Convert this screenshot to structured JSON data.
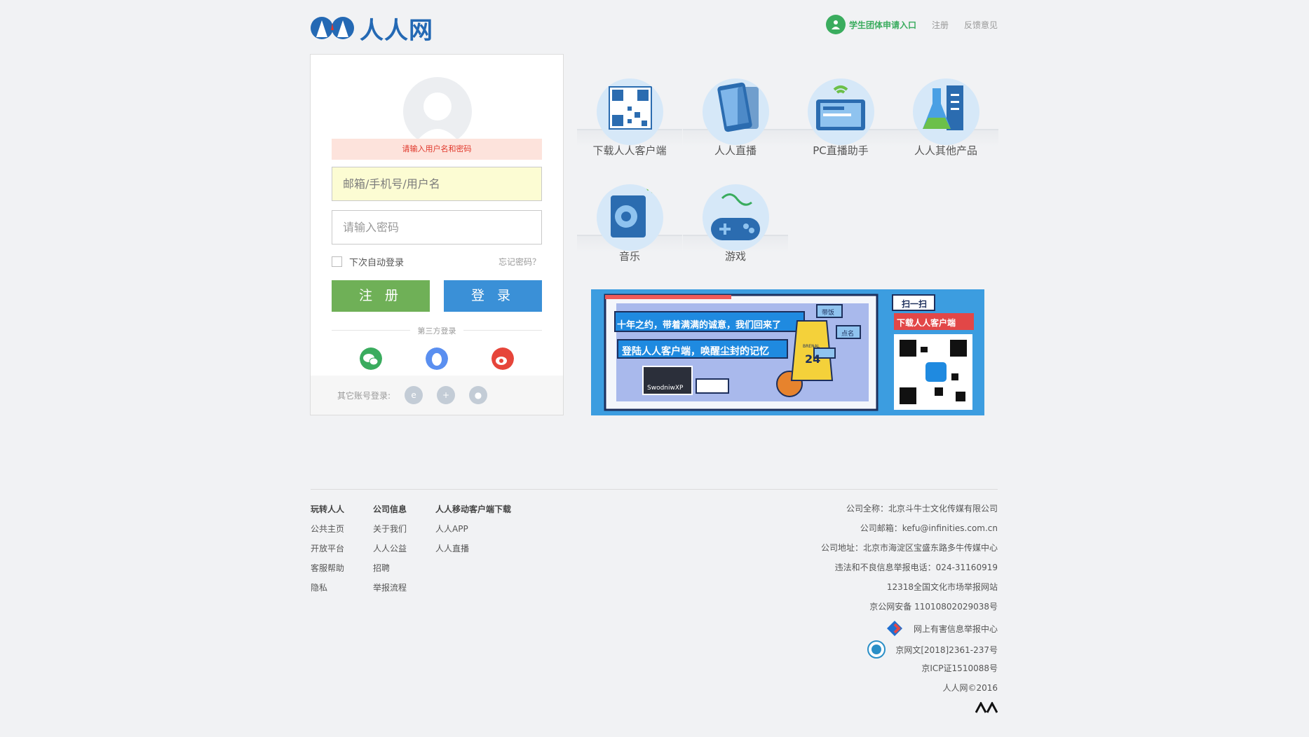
{
  "header": {
    "logo_text": "人人网",
    "student_entry": "学生团体申请入口",
    "register_link": "注册",
    "feedback_link": "反馈意见"
  },
  "login": {
    "error_message": "请输入用户名和密码",
    "username_placeholder": "邮箱/手机号/用户名",
    "password_placeholder": "请输入密码",
    "remember_label": "下次自动登录",
    "forgot_label": "忘记密码？",
    "register_button": "注 册",
    "login_button": "登 录",
    "third_party_title": "第三方登录",
    "third_party_icons": [
      "wechat-icon",
      "qq-icon",
      "weibo-icon"
    ],
    "other_accounts_label": "其它账号登录:",
    "other_icons": [
      "tianyi-icon",
      "plus-icon",
      "baidu-paw-icon"
    ]
  },
  "products": [
    {
      "label": "下载人人客户端",
      "icon": "qrcode-icon"
    },
    {
      "label": "人人直播",
      "icon": "phone-icon"
    },
    {
      "label": "PC直播助手",
      "icon": "pc-live-icon"
    },
    {
      "label": "人人其他产品",
      "icon": "flask-icon"
    },
    {
      "label": "音乐",
      "icon": "speaker-icon"
    },
    {
      "label": "游戏",
      "icon": "gamepad-icon"
    }
  ],
  "banner": {
    "line1": "十年之约，带着满满的诚意，我们回来了",
    "line2": "登陆人人客户端，唤醒尘封的记忆",
    "scan_label": "扫一扫",
    "download_label": "下载人人客户端",
    "tag1": "带饭",
    "tag2": "点名",
    "jersey_number": "24",
    "jersey_text": "BRENAL",
    "console_text": "SwodniwXP"
  },
  "footer": {
    "col1": {
      "title": "玩转人人",
      "links": [
        "公共主页",
        "开放平台",
        "客服帮助",
        "隐私"
      ]
    },
    "col2": {
      "title": "公司信息",
      "links": [
        "关于我们",
        "人人公益",
        "招聘",
        "举报流程"
      ]
    },
    "col3": {
      "title": "人人移动客户端下载",
      "links": [
        "人人APP",
        "人人直播"
      ]
    },
    "company_name": "公司全称：北京斗牛士文化传媒有限公司",
    "company_email": "公司邮箱：kefu@infinities.com.cn",
    "company_address": "公司地址：北京市海淀区宝盛东路多牛传媒中心",
    "report_phone": "违法和不良信息举报电话：024-31160919",
    "culture_report": "12318全国文化市场举报网站",
    "police_record": "京公网安备 11010802029038号",
    "harmful_info": "网上有害信息举报中心",
    "culture_license": "京网文[2018]2361-237号",
    "icp": "京ICP证1510088号",
    "copyright": "人人网©2016"
  },
  "colors": {
    "brand_blue": "#2469b4",
    "register_green": "#6fb057",
    "login_blue": "#3a90d7",
    "error_bg": "#fde3dc",
    "error_text": "#e0372a",
    "student_green": "#3aac5e"
  }
}
